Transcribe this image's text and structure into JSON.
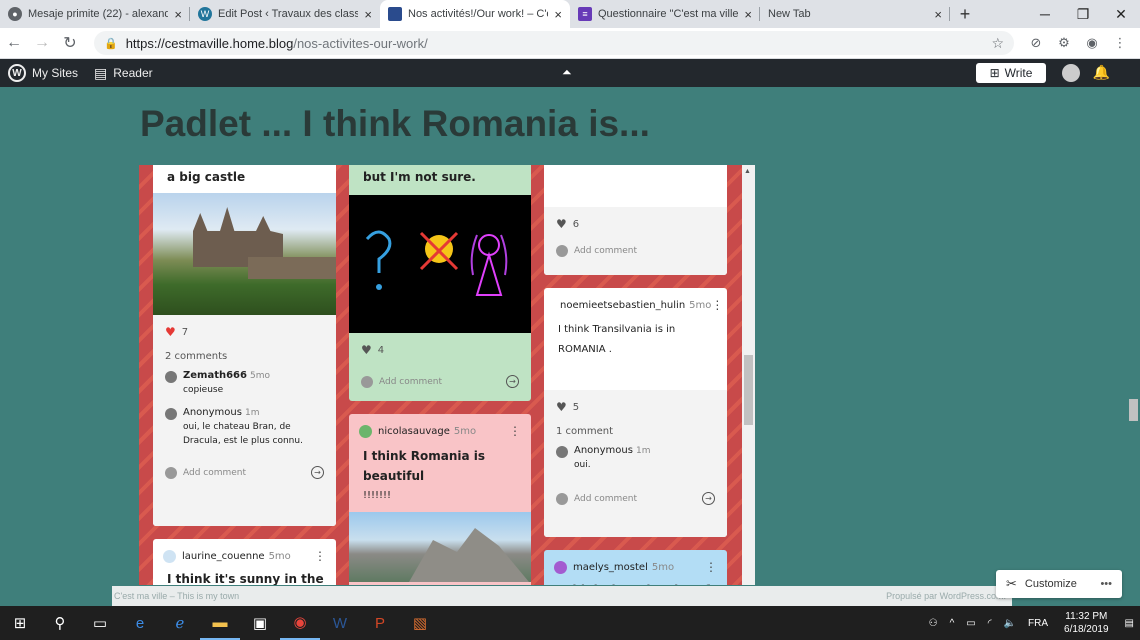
{
  "browser": {
    "tabs": [
      {
        "label": "Mesaje primite (22) - alexandra",
        "fav_color": "#5f6368",
        "active": false
      },
      {
        "label": "Edit Post ‹ Travaux des classes",
        "fav_color": "#21759b",
        "active": false
      },
      {
        "label": "Nos activités!/Our work! – C'est",
        "fav_color": "#2a4b8d",
        "active": true
      },
      {
        "label": "Questionnaire \"C'est ma ville\"",
        "fav_color": "#673ab7",
        "active": false
      },
      {
        "label": "New Tab",
        "fav_color": "#dee1e6",
        "active": false
      }
    ],
    "url_host": "https://cestmaville.home.blog",
    "url_path": "/nos-activites-our-work/"
  },
  "adminbar": {
    "my_sites": "My Sites",
    "reader": "Reader",
    "write": "Write"
  },
  "page": {
    "title": "Padlet ... I think Romania is..."
  },
  "padlet": {
    "col1": {
      "top_card_title": "a big castle",
      "likes": "7",
      "comment_count": "2 comments",
      "comments": [
        {
          "name": "Zemath666",
          "age": "5mo",
          "text": "copieuse"
        },
        {
          "name": "Anonymous",
          "age": "1m",
          "text": "oui, le chateau Bran, de Dracula, est le plus connu."
        }
      ],
      "add_comment": "Add comment",
      "card2_author": "laurine_couenne",
      "card2_age": "5mo",
      "card2_title": "I think it's sunny in the summer"
    },
    "col2": {
      "top_card_title": "but I'm not sure.",
      "likes": "4",
      "add_comment": "Add comment",
      "card2_author": "nicolasauvage",
      "card2_age": "5mo",
      "card2_title": "I think Romania is beautiful",
      "card2_body": "!!!!!!!"
    },
    "col3": {
      "likes": "6",
      "add_comment": "Add comment",
      "card2_author": "noemieetsebastien_hulin",
      "card2_age": "5mo",
      "card2_body": "I think Transilvania is in ROMANIA .",
      "card2_likes": "5",
      "card2_comment_count": "1 comment",
      "card2_comment": {
        "name": "Anonymous",
        "age": "1m",
        "text": "oui."
      },
      "card2_add_comment": "Add comment",
      "card3_author": "maelys_mostel",
      "card3_age": "5mo",
      "card3_title": "I think there is a lot of"
    }
  },
  "footer": {
    "left": "C'est ma ville – This is my town",
    "right": "Propulsé par WordPress.com.",
    "customize": "Customize"
  },
  "taskbar": {
    "lang": "FRA",
    "time": "11:32 PM",
    "date": "6/18/2019"
  }
}
